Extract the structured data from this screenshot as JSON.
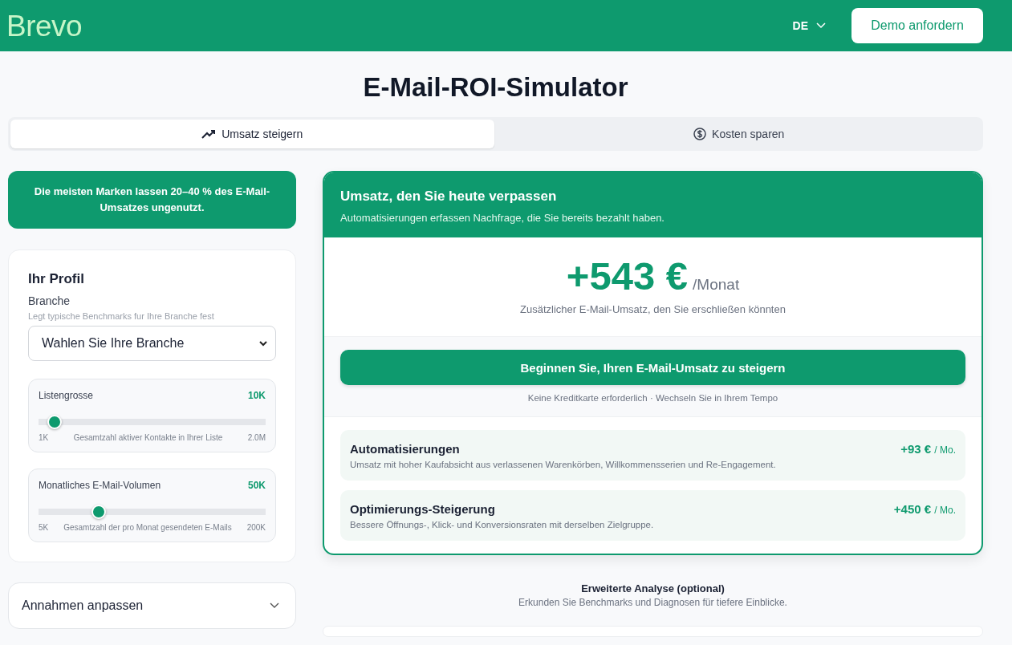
{
  "header": {
    "logo": "Brevo",
    "language": "DE",
    "demo_button": "Demo anfordern"
  },
  "title": "E-Mail-ROI-Simulator",
  "tabs": [
    {
      "label": "Umsatz steigern",
      "kind": "trend",
      "selected": true
    },
    {
      "label": "Kosten sparen",
      "kind": "dollar",
      "selected": false
    }
  ],
  "banner": "Die meisten Marken lassen 20–40 % des E-Mail-Umsatzes ungenutzt.",
  "profile": {
    "heading": "Ihr Profil",
    "industry_label": "Branche",
    "industry_hint": "Legt typische Benchmarks fur Ihre Branche fest",
    "industry_select": "Wahlen Sie Ihre Branche",
    "sliders": [
      {
        "label": "Listengrosse",
        "value": "10K",
        "level": 0.04,
        "min": "1K",
        "caption": "Gesamtzahl aktiver Kontakte in Ihrer Liste",
        "max": "2.0M"
      },
      {
        "label": "Monatliches E-Mail-Volumen",
        "value": "50K",
        "level": 0.25,
        "min": "5K",
        "caption": "Gesamtzahl der pro Monat gesendeten E-Mails",
        "max": "200K"
      }
    ]
  },
  "assumptions": {
    "label": "Annahmen anpassen",
    "expanded": false
  },
  "result": {
    "heading": "Umsatz, den Sie heute verpassen",
    "subheading": "Automatisierungen erfassen Nachfrage, die Sie bereits bezahlt haben.",
    "amount": "+543 €",
    "period": "/Monat",
    "amount_caption": "Zusätzlicher E-Mail-Umsatz, den Sie erschließen könnten",
    "cta": "Beginnen Sie, Ihren E-Mail-Umsatz zu steigern",
    "cta_note": "Keine Kreditkarte erforderlich · Wechseln Sie in Ihrem Tempo",
    "items": [
      {
        "title": "Automatisierungen",
        "description": "Umsatz mit hoher Kaufabsicht aus verlassenen Warenkörben, Willkommensserien und Re-Engagement.",
        "amount": "+93 €",
        "unit": "/ Mo."
      },
      {
        "title": "Optimierungs-Steigerung",
        "description": "Bessere Öffnungs-, Klick- und Konversionsraten mit derselben Zielgruppe.",
        "amount": "+450 €",
        "unit": "/ Mo."
      }
    ]
  },
  "advanced": {
    "heading": "Erweiterte Analyse (optional)",
    "subheading": "Erkunden Sie Benchmarks und Diagnosen für tiefere Einblicke."
  }
}
